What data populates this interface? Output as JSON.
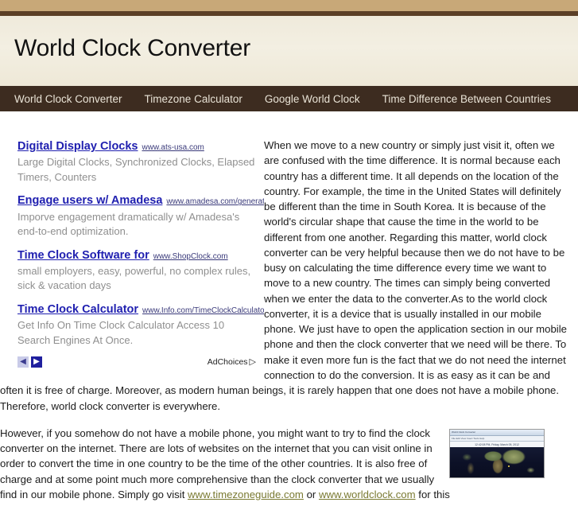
{
  "header": {
    "site_title": "World Clock Converter",
    "top_bar_color": "#c8a878",
    "rule_color": "#5b3f26",
    "masthead_bg": "#efeadb"
  },
  "nav": {
    "items": [
      {
        "label": "World Clock Converter"
      },
      {
        "label": "Timezone Calculator"
      },
      {
        "label": "Google World Clock"
      },
      {
        "label": "Time Difference Between Countries"
      }
    ],
    "bg_color": "#3d2c20",
    "text_color": "#e9e3d6"
  },
  "ads": {
    "units": [
      {
        "title": "Digital Display Clocks",
        "url": "www.ats-usa.com",
        "description": "Large Digital Clocks, Synchronized Clocks, Elapsed Timers, Counters"
      },
      {
        "title": "Engage users w/ Amadesa",
        "url": "www.amadesa.com/generate-le",
        "description": "Imporve engagement dramatically w/ Amadesa's end-to-end optimization."
      },
      {
        "title": "Time Clock Software for",
        "url": "www.ShopClock.com",
        "description": "small employers, easy, powerful, no complex rules, sick & vacation days"
      },
      {
        "title": "Time Clock Calculator",
        "url": "www.Info.com/TimeClockCalculator",
        "description": "Get Info On Time Clock Calculator Access 10 Search Engines At Once."
      }
    ],
    "prev_arrow": "◀",
    "next_arrow": "▶",
    "adchoices_label": "AdChoices",
    "adchoices_glyph": "▷",
    "link_color": "#2020b0",
    "desc_color": "#8f8f8f"
  },
  "article": {
    "paragraph_1": "When we move to a new country or simply just visit it, often we are confused with the time difference. It is normal because each country has a different time. It all depends on the location of the country. For example, the time in the United States will definitely be different than the time in South Korea. It is because of the world's circular shape that cause the time in the world to be different from one another. Regarding this matter, world clock converter can be very helpful because then we do not have to be busy on calculating the time difference every time we want to move to a new country. The times can simply being converted when we enter the data to the converter.As to the world clock converter, it is a device that is usually installed in our mobile phone. We just have to open the application section in our mobile phone and then the clock converter that we need will be there. To make it even more fun is the fact that we do not need the internet connection to do the conversion. It is as easy as it can be and often it is free of charge. Moreover, as modern human beings, it is rarely happen that one does not have a mobile phone. Therefore, world clock converter is everywhere.",
    "paragraph_2_before": "However, if you somehow do not have a mobile phone, you might want to try to find the clock converter on the internet. There are lots of websites on the internet that you can visit online in order to convert the time in one country to be the time of the other countries. It is also free of charge and at some point much more comprehensive than the clock converter that we usually find in our mobile phone. Simply go visit ",
    "link_1": "www.timezoneguide.com",
    "paragraph_2_middle": " or ",
    "link_2": "www.worldclock.com",
    "paragraph_2_after": " for this"
  },
  "thumbnail": {
    "window_title": "World Clock Converter",
    "menu_text": "File Edit View Insert Tools Help",
    "timestamp_text": "12:42:08 PM, Friday, March 09, 2012",
    "alt": "world-map-timezone-screenshot"
  }
}
